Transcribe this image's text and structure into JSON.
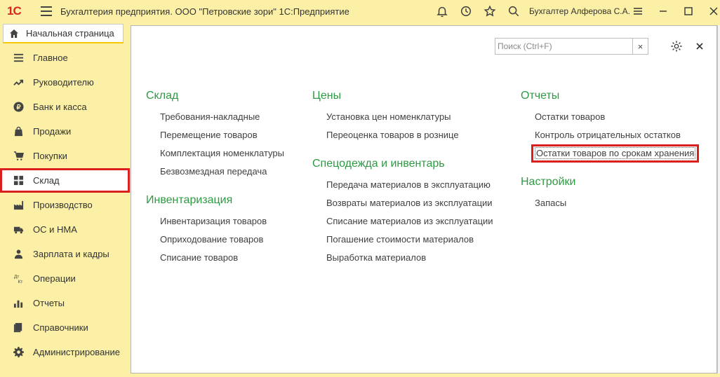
{
  "window": {
    "logo": "1С",
    "title": "Бухгалтерия предприятия. ООО \"Петровские зори\" 1С:Предприятие",
    "user": "Бухгалтер Алферова С.А."
  },
  "tabs": [
    {
      "label": "Начальная страница",
      "icon": "home-icon",
      "active": true
    }
  ],
  "nav": {
    "items": [
      {
        "label": "Главное",
        "icon": "list-icon",
        "active": false
      },
      {
        "label": "Руководителю",
        "icon": "trend-icon",
        "active": false
      },
      {
        "label": "Банк и касса",
        "icon": "ruble-icon",
        "active": false
      },
      {
        "label": "Продажи",
        "icon": "bag-icon",
        "active": false
      },
      {
        "label": "Покупки",
        "icon": "cart-icon",
        "active": false
      },
      {
        "label": "Склад",
        "icon": "warehouse-icon",
        "active": true
      },
      {
        "label": "Производство",
        "icon": "factory-icon",
        "active": false
      },
      {
        "label": "ОС и НМА",
        "icon": "truck-icon",
        "active": false
      },
      {
        "label": "Зарплата и кадры",
        "icon": "person-icon",
        "active": false
      },
      {
        "label": "Операции",
        "icon": "dt-kt-icon",
        "active": false
      },
      {
        "label": "Отчеты",
        "icon": "bar-chart-icon",
        "active": false
      },
      {
        "label": "Справочники",
        "icon": "book-icon",
        "active": false
      },
      {
        "label": "Администрирование",
        "icon": "gear-icon",
        "active": false
      }
    ],
    "dt_kt_text": {
      "top": "Дт",
      "bottom": "Кт"
    }
  },
  "search": {
    "placeholder": "Поиск (Ctrl+F)",
    "value": "",
    "clear_label": "×"
  },
  "columns": [
    {
      "groups": [
        {
          "title": "Склад",
          "links": [
            {
              "label": "Требования-накладные"
            },
            {
              "label": "Перемещение товаров"
            },
            {
              "label": "Комплектация номенклатуры"
            },
            {
              "label": "Безвозмездная передача"
            }
          ]
        },
        {
          "title": "Инвентаризация",
          "links": [
            {
              "label": "Инвентаризация товаров"
            },
            {
              "label": "Оприходование товаров"
            },
            {
              "label": "Списание товаров"
            }
          ]
        }
      ]
    },
    {
      "groups": [
        {
          "title": "Цены",
          "links": [
            {
              "label": "Установка цен номенклатуры"
            },
            {
              "label": "Переоценка товаров в рознице"
            }
          ]
        },
        {
          "title": "Спецодежда и инвентарь",
          "links": [
            {
              "label": "Передача материалов в эксплуатацию"
            },
            {
              "label": "Возвраты материалов из эксплуатации"
            },
            {
              "label": "Списание материалов из эксплуатации"
            },
            {
              "label": "Погашение стоимости материалов"
            },
            {
              "label": "Выработка материалов"
            }
          ]
        }
      ]
    },
    {
      "groups": [
        {
          "title": "Отчеты",
          "links": [
            {
              "label": "Остатки товаров"
            },
            {
              "label": "Контроль отрицательных остатков"
            },
            {
              "label": "Остатки товаров по срокам хранения",
              "highlight": true
            }
          ]
        },
        {
          "title": "Настройки",
          "links": [
            {
              "label": "Запасы"
            }
          ]
        }
      ]
    }
  ],
  "colors": {
    "background": "#fbf0a6",
    "group_title": "#2f9a44",
    "highlight_border": "#d9201d",
    "logo": "#d6281e"
  }
}
